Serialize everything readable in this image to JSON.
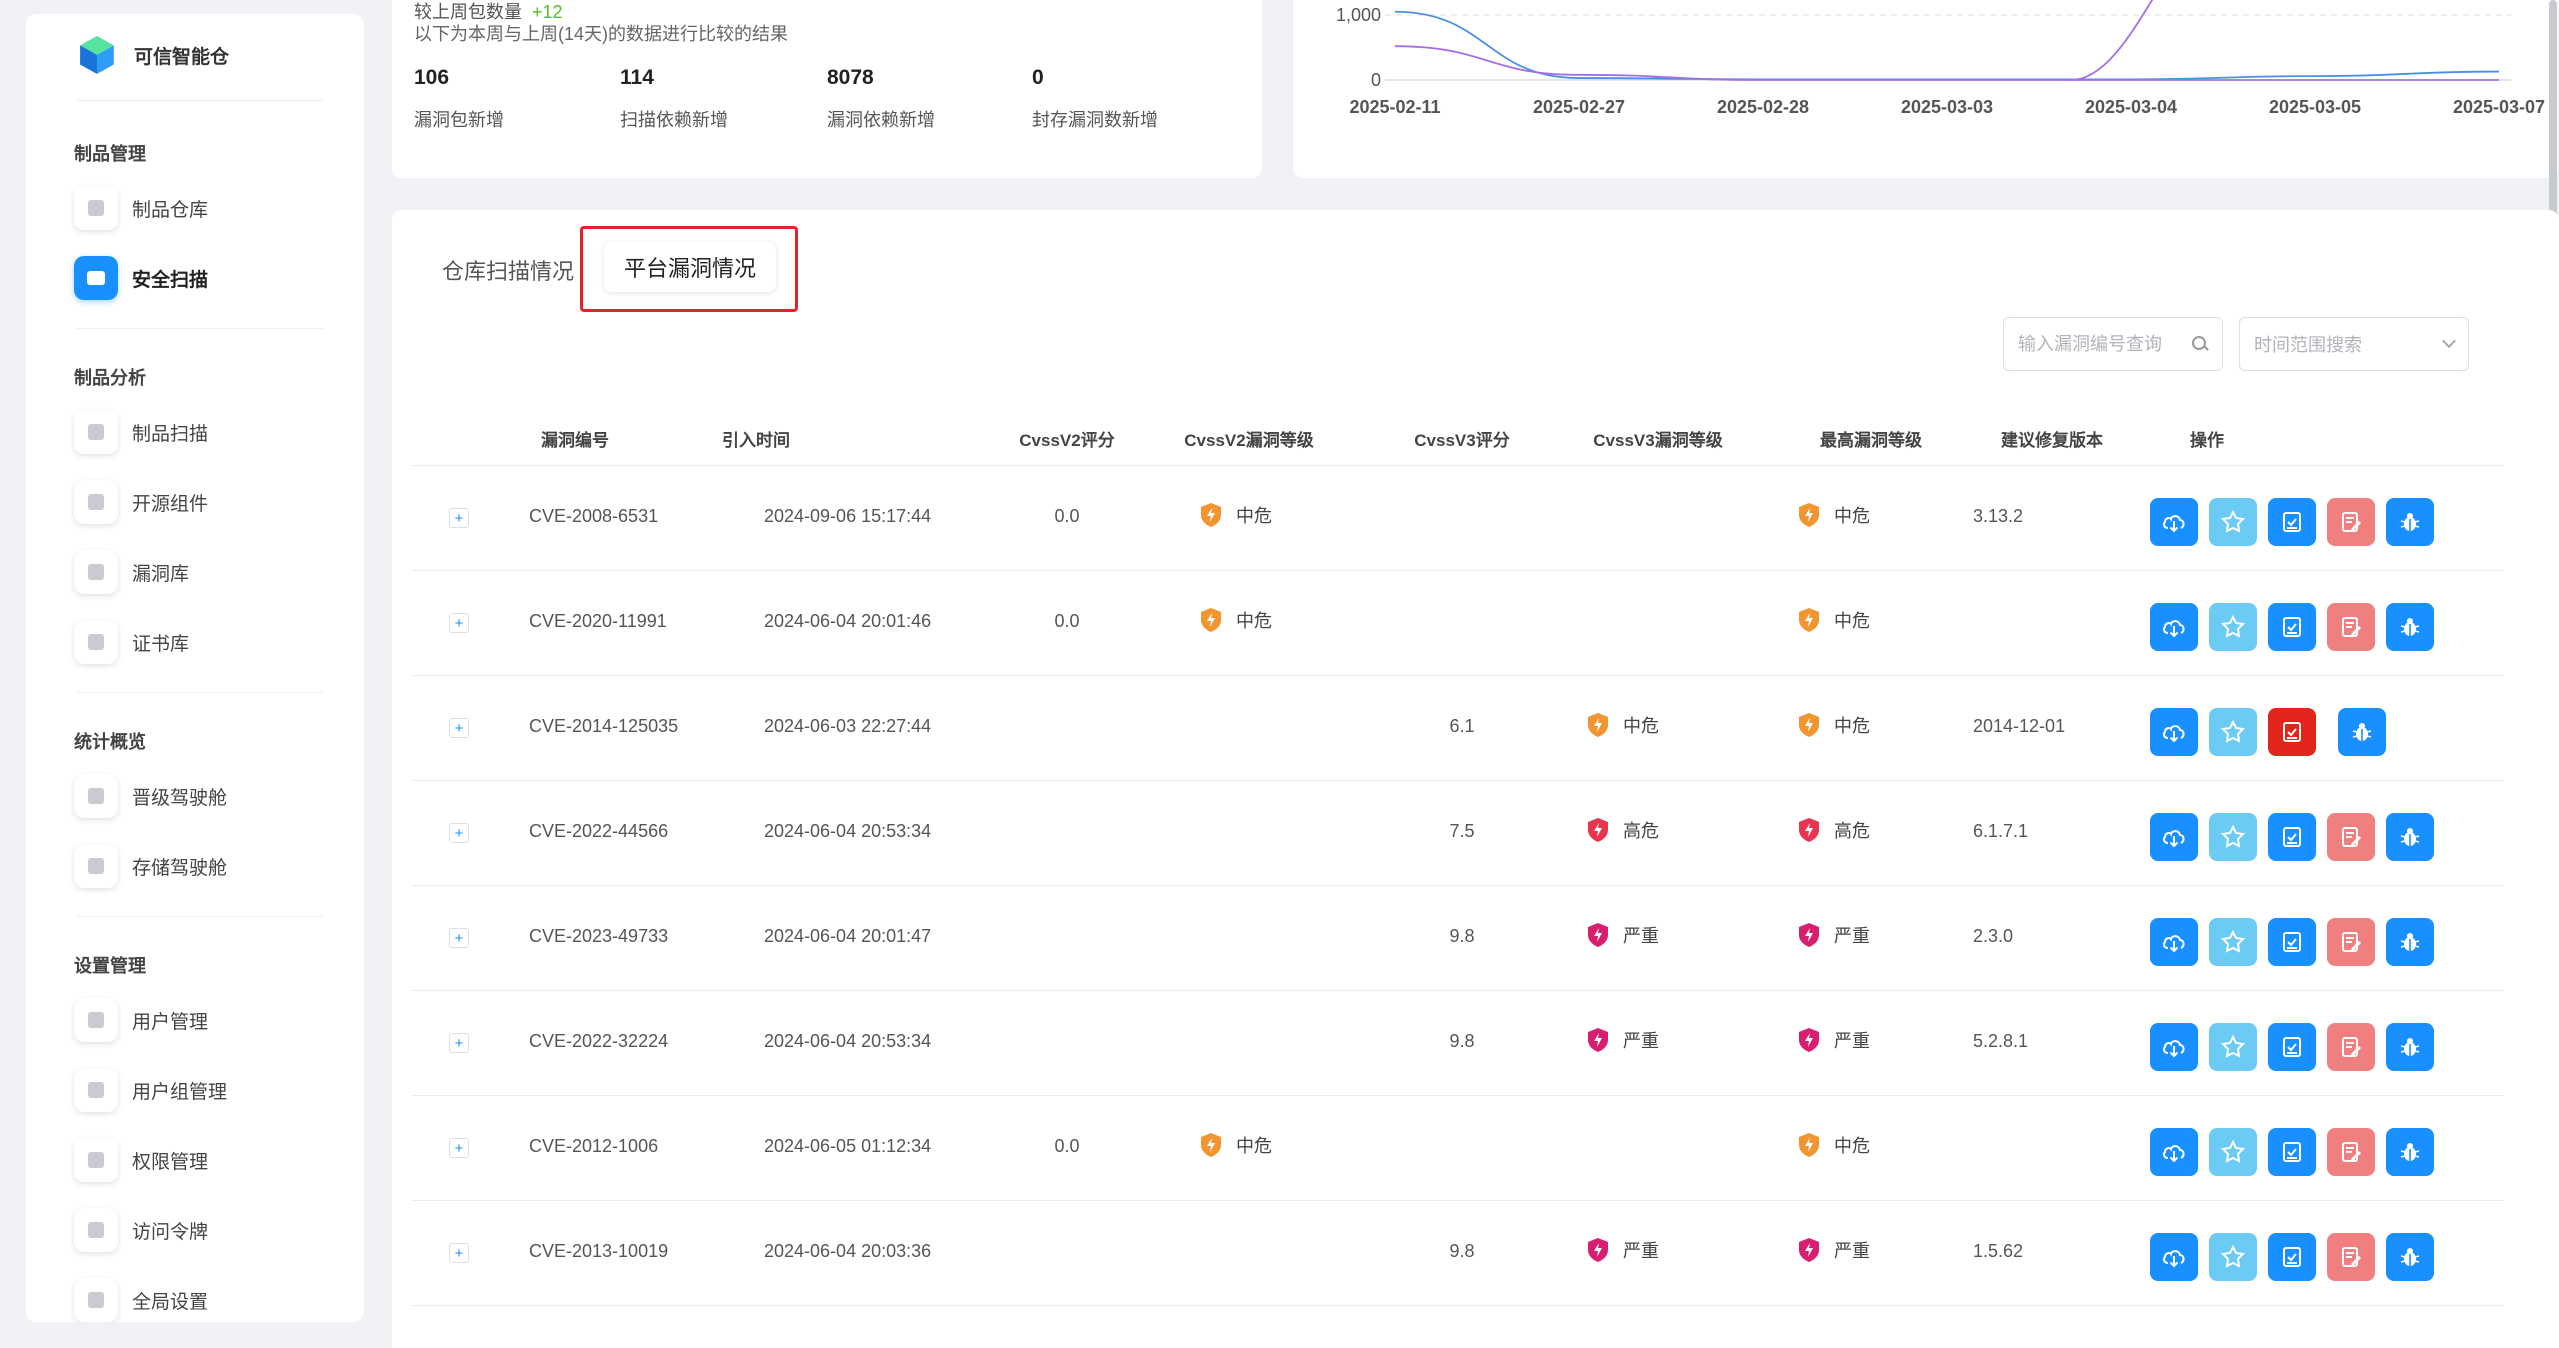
{
  "brand": {
    "name": "可信智能仓"
  },
  "sidebar": {
    "groups": [
      {
        "title": "制品管理",
        "items": [
          {
            "label": "制品仓库",
            "icon": "grid-icon"
          },
          {
            "label": "安全扫描",
            "icon": "scan-icon",
            "active": true
          }
        ]
      },
      {
        "title": "制品分析",
        "items": [
          {
            "label": "制品扫描",
            "icon": "scan-doc-icon"
          },
          {
            "label": "开源组件",
            "icon": "component-icon"
          },
          {
            "label": "漏洞库",
            "icon": "bug-db-icon"
          },
          {
            "label": "证书库",
            "icon": "certificate-icon"
          }
        ]
      },
      {
        "title": "统计概览",
        "items": [
          {
            "label": "晋级驾驶舱",
            "icon": "promote-icon"
          },
          {
            "label": "存储驾驶舱",
            "icon": "storage-icon"
          }
        ]
      },
      {
        "title": "设置管理",
        "items": [
          {
            "label": "用户管理",
            "icon": "user-icon"
          },
          {
            "label": "用户组管理",
            "icon": "user-group-icon"
          },
          {
            "label": "权限管理",
            "icon": "permission-icon"
          },
          {
            "label": "访问令牌",
            "icon": "lock-icon"
          },
          {
            "label": "全局设置",
            "icon": "wrench-icon"
          }
        ]
      }
    ]
  },
  "stats": {
    "compare_label": "较上周包数量",
    "compare_delta": "+12",
    "subtitle": "以下为本周与上周(14天)的数据进行比较的结果",
    "metrics": [
      {
        "value": "106",
        "label": "漏洞包新增"
      },
      {
        "value": "114",
        "label": "扫描依赖新增"
      },
      {
        "value": "8078",
        "label": "漏洞依赖新增"
      },
      {
        "value": "0",
        "label": "封存漏洞数新增"
      }
    ]
  },
  "chart_data": {
    "type": "line",
    "x": [
      "2025-02-11",
      "2025-02-27",
      "2025-02-28",
      "2025-03-03",
      "2025-03-04",
      "2025-03-05",
      "2025-03-07"
    ],
    "y_ticks": [
      "1,000",
      "0"
    ],
    "series": [
      {
        "color": "#4a90e2",
        "values": [
          1050,
          30,
          10,
          10,
          10,
          60,
          130
        ]
      },
      {
        "color": "#a46ee8",
        "values": [
          520,
          80,
          0,
          0,
          0,
          0,
          0
        ]
      }
    ],
    "purple_spike": {
      "from_x": "2025-03-04",
      "rising": true
    }
  },
  "tabs": {
    "scan": "仓库扫描情况",
    "vuln": "平台漏洞情况"
  },
  "filters": {
    "search_placeholder": "输入漏洞编号查询",
    "date_placeholder": "时间范围搜索"
  },
  "table": {
    "headers": [
      "漏洞编号",
      "引入时间",
      "CvssV2评分",
      "CvssV2漏洞等级",
      "CvssV3评分",
      "CvssV3漏洞等级",
      "最高漏洞等级",
      "建议修复版本",
      "操作"
    ],
    "rows": [
      {
        "id": "CVE-2008-6531",
        "time": "2024-09-06 15:17:44",
        "v2score": "0.0",
        "v2level": "中危",
        "v3score": "",
        "v3level": "",
        "max": "中危",
        "fix": "3.13.2",
        "red": false
      },
      {
        "id": "CVE-2020-11991",
        "time": "2024-06-04 20:01:46",
        "v2score": "0.0",
        "v2level": "中危",
        "v3score": "",
        "v3level": "",
        "max": "中危",
        "fix": "",
        "red": false
      },
      {
        "id": "CVE-2014-125035",
        "time": "2024-06-03 22:27:44",
        "v2score": "",
        "v2level": "",
        "v3score": "6.1",
        "v3level": "中危",
        "max": "中危",
        "fix": "2014-12-01",
        "red": true
      },
      {
        "id": "CVE-2022-44566",
        "time": "2024-06-04 20:53:34",
        "v2score": "",
        "v2level": "",
        "v3score": "7.5",
        "v3level": "高危",
        "max": "高危",
        "fix": "6.1.7.1",
        "red": false
      },
      {
        "id": "CVE-2023-49733",
        "time": "2024-06-04 20:01:47",
        "v2score": "",
        "v2level": "",
        "v3score": "9.8",
        "v3level": "严重",
        "max": "严重",
        "fix": "2.3.0",
        "red": false
      },
      {
        "id": "CVE-2022-32224",
        "time": "2024-06-04 20:53:34",
        "v2score": "",
        "v2level": "",
        "v3score": "9.8",
        "v3level": "严重",
        "max": "严重",
        "fix": "5.2.8.1",
        "red": false
      },
      {
        "id": "CVE-2012-1006",
        "time": "2024-06-05 01:12:34",
        "v2score": "0.0",
        "v2level": "中危",
        "v3score": "",
        "v3level": "",
        "max": "中危",
        "fix": "",
        "red": false
      },
      {
        "id": "CVE-2013-10019",
        "time": "2024-06-04 20:03:36",
        "v2score": "",
        "v2level": "",
        "v3score": "9.8",
        "v3level": "严重",
        "max": "严重",
        "fix": "1.5.62",
        "red": false
      }
    ]
  },
  "severity_colors": {
    "中危": "#f0952f",
    "高危": "#e8344e",
    "严重": "#d81e6e"
  }
}
